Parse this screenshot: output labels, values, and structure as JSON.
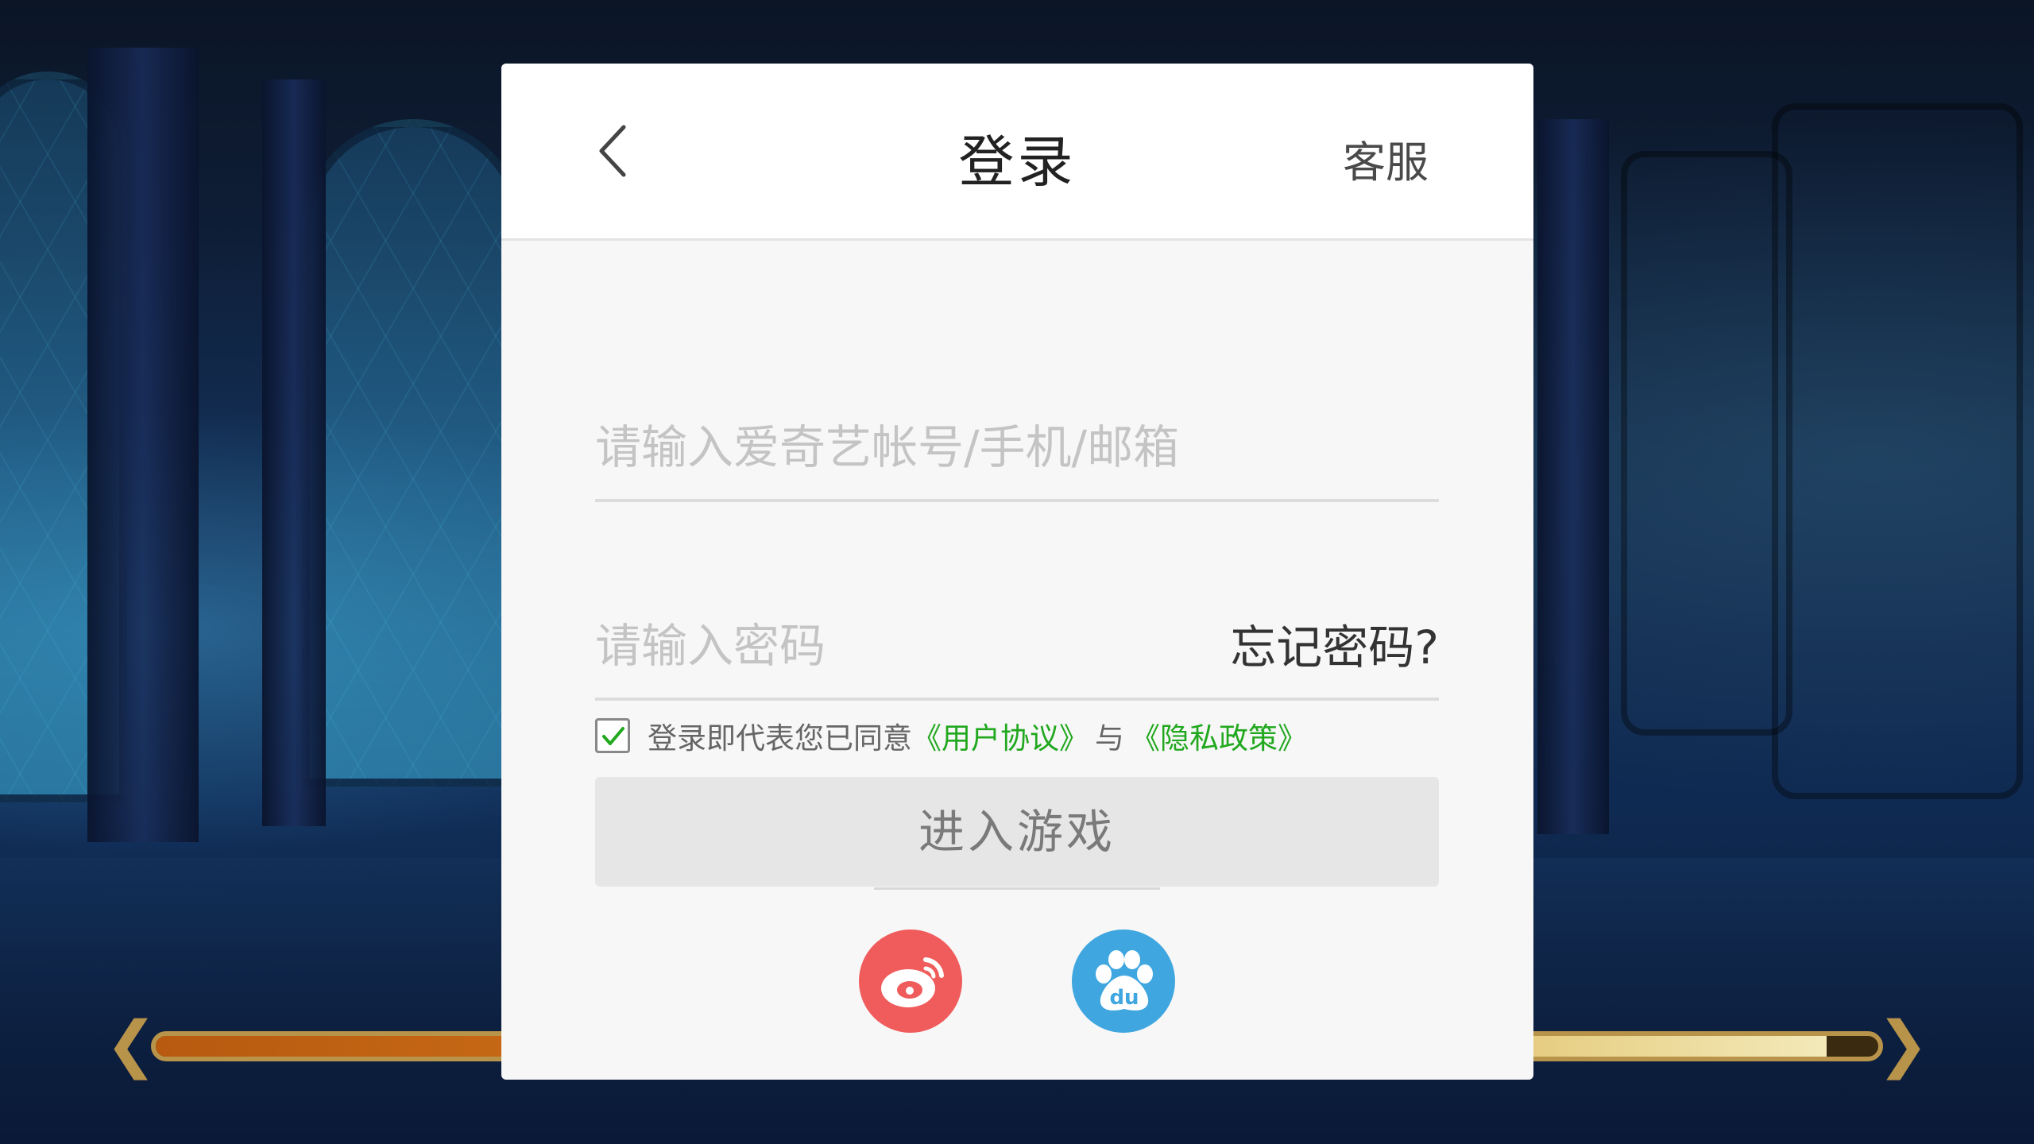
{
  "dialog": {
    "title": "登录",
    "service_label": "客服",
    "account_placeholder": "请输入爱奇艺帐号/手机/邮箱",
    "account_value": "",
    "password_placeholder": "请输入密码",
    "password_value": "",
    "forgot_label": "忘记密码?",
    "agree": {
      "checked": true,
      "prefix": "登录即代表您已同意",
      "user_agreement": "《用户协议》",
      "separator": "与",
      "privacy_policy": "《隐私政策》"
    },
    "enter_label": "进入游戏",
    "social_logins": [
      {
        "name": "weibo-icon",
        "color": "#f05b5b"
      },
      {
        "name": "baidu-icon",
        "color": "#3fa6df",
        "text": "du"
      }
    ]
  },
  "background": {
    "loading_progress": 0.97
  },
  "colors": {
    "accent_green": "#21a81e",
    "button_disabled_bg": "#e6e6e6"
  }
}
